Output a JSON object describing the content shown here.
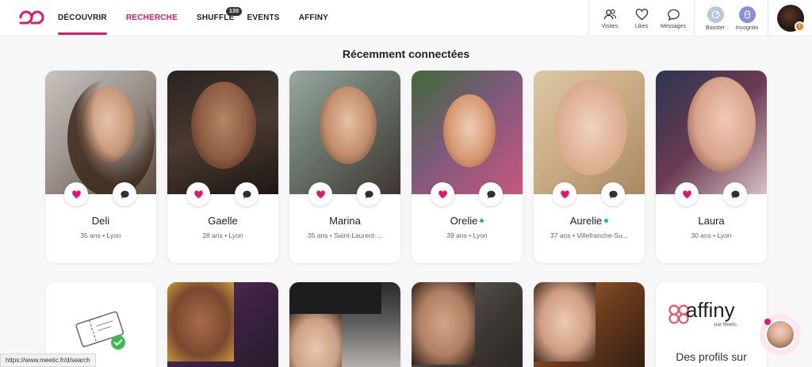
{
  "nav": {
    "links": [
      {
        "label": "DÉCOUVRIR"
      },
      {
        "label": "RECHERCHE"
      },
      {
        "label": "SHUFFLE",
        "badge": "130"
      },
      {
        "label": "EVENTS"
      },
      {
        "label": "AFFINY"
      }
    ],
    "icons": [
      {
        "label": "Visites",
        "icon": "visits-icon"
      },
      {
        "label": "Likes",
        "icon": "heart-icon"
      },
      {
        "label": "Messages",
        "icon": "message-icon"
      }
    ],
    "features": [
      {
        "label": "Booster",
        "icon": "booster-icon"
      },
      {
        "label": "Incognito",
        "icon": "incognito-icon"
      }
    ],
    "profile_badge": "!"
  },
  "section": {
    "title": "Récemment connectées"
  },
  "profiles": [
    {
      "name": "Deli",
      "meta": "35 ans • Lyon",
      "online": false
    },
    {
      "name": "Gaelle",
      "meta": "28 ans • Lyon",
      "online": false
    },
    {
      "name": "Marina",
      "meta": "35 ans • Saint-Laurent-...",
      "online": false
    },
    {
      "name": "Orelie",
      "meta": "39 ans • Lyon",
      "online": true
    },
    {
      "name": "Aurelie",
      "meta": "37 ans • Villefranche-Su...",
      "online": true
    },
    {
      "name": "Laura",
      "meta": "30 ans • Lyon",
      "online": false
    }
  ],
  "affiny": {
    "wordmark": "affiny",
    "sub": "par Meetic",
    "desc": "Des profils sur"
  },
  "status_url": "https://www.meetic.fr/d/search",
  "colors": {
    "brand": "#e0186d",
    "online": "#1bb7a8",
    "badge": "#ef7d1d"
  }
}
